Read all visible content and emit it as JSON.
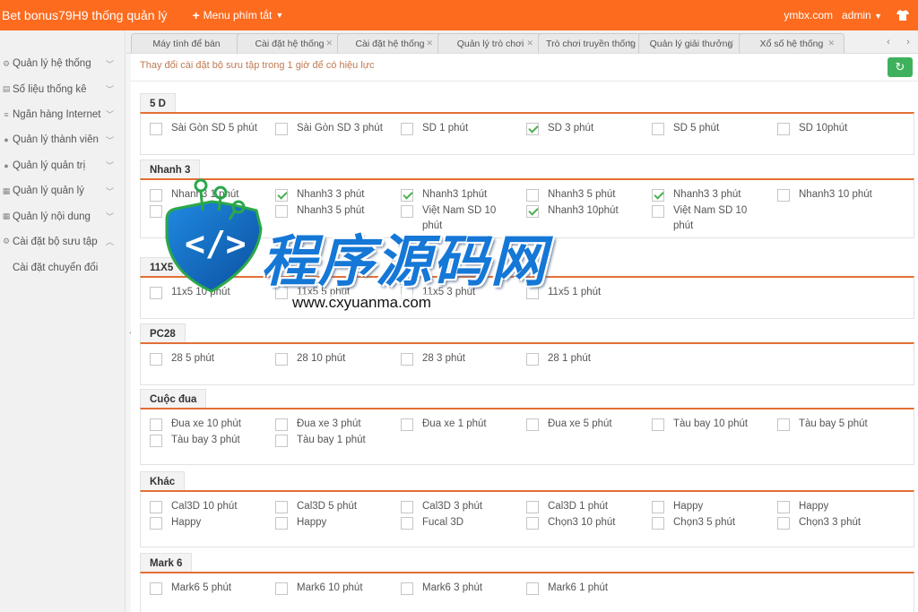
{
  "topbar": {
    "brand": "Bet bonus79H9 thống quản lý",
    "shortcut_label": "Menu phím tắt",
    "domain": "ymbx.com",
    "user": "admin"
  },
  "sidebar": {
    "items": [
      {
        "label": "Quản lý hệ thống",
        "icon": "gear-icon"
      },
      {
        "label": "Số liệu thống kê",
        "icon": "stats-icon"
      },
      {
        "label": "Ngân hàng Internet",
        "icon": "list-icon"
      },
      {
        "label": "Quản lý thành viên",
        "icon": "user-icon"
      },
      {
        "label": "Quản lý quản trị",
        "icon": "admin-icon"
      },
      {
        "label": "Quản lý quản lý",
        "icon": "grid-icon"
      },
      {
        "label": "Quản lý nội dung",
        "icon": "content-icon"
      },
      {
        "label": "Cài đặt bộ sưu tập",
        "icon": "settings-icon"
      }
    ],
    "sub_item": "Cài đặt chuyển đổi"
  },
  "tabs": [
    "Máy tính để bàn",
    "Cài đặt hệ thống",
    "Cài đặt hệ thống",
    "Quản lý trò chơi",
    "Trò chơi truyền thống",
    "Quản lý giải thưởng",
    "Xổ số hệ thống"
  ],
  "content": {
    "notice": "Thay đổi cài đặt bộ sưu tập trong 1 giờ để có hiệu lực"
  },
  "sections": [
    {
      "title": "5 D",
      "rows": [
        [
          {
            "label": "Sài Gòn SD 5 phút",
            "checked": false
          },
          {
            "label": "Sài Gòn SD 3 phút",
            "checked": false
          },
          {
            "label": "SD 1 phút",
            "checked": false
          },
          {
            "label": "SD 3 phút",
            "checked": true
          },
          {
            "label": "SD 5 phút",
            "checked": false
          },
          {
            "label": "SD 10phút",
            "checked": false
          }
        ]
      ]
    },
    {
      "title": "Nhanh 3",
      "rows": [
        [
          {
            "label": "Nhanh3 1 phút",
            "checked": false
          },
          {
            "label": "Nhanh3 3 phút",
            "checked": true
          },
          {
            "label": "Nhanh3 1phút",
            "checked": true
          },
          {
            "label": "Nhanh3 5 phút",
            "checked": false
          },
          {
            "label": "Nhanh3 3 phút",
            "checked": true
          },
          {
            "label": "Nhanh3 10 phút",
            "checked": false
          }
        ],
        [
          {
            "label": "",
            "checked": false
          },
          {
            "label": "Nhanh3 5 phút",
            "checked": false
          },
          {
            "label": "Việt Nam SD 10 phút",
            "checked": false
          },
          {
            "label": "Nhanh3 10phút",
            "checked": true
          },
          {
            "label": "Việt Nam SD 10 phút",
            "checked": false
          }
        ]
      ]
    },
    {
      "title": "11X5",
      "rows": [
        [
          {
            "label": "11x5 10 phút",
            "checked": false
          },
          {
            "label": "11x5 5 phút",
            "checked": false
          },
          {
            "label": "11x5 3 phút",
            "checked": false
          },
          {
            "label": "11x5 1 phút",
            "checked": false
          }
        ]
      ]
    },
    {
      "title": "PC28",
      "rows": [
        [
          {
            "label": "28 5 phút",
            "checked": false
          },
          {
            "label": "28 10 phút",
            "checked": false
          },
          {
            "label": "28 3 phút",
            "checked": false
          },
          {
            "label": "28 1 phút",
            "checked": false
          }
        ]
      ]
    },
    {
      "title": "Cuộc đua",
      "rows": [
        [
          {
            "label": "Đua xe 10 phút",
            "checked": false
          },
          {
            "label": "Đua xe 3 phút",
            "checked": false
          },
          {
            "label": "Đua xe 1 phút",
            "checked": false
          },
          {
            "label": "Đua xe 5 phút",
            "checked": false
          },
          {
            "label": "Tàu bay 10 phút",
            "checked": false
          },
          {
            "label": "Tàu bay 5 phút",
            "checked": false
          }
        ],
        [
          {
            "label": "Tàu bay 3 phút",
            "checked": false
          },
          {
            "label": "Tàu bay 1 phút",
            "checked": false
          }
        ]
      ]
    },
    {
      "title": "Khác",
      "rows": [
        [
          {
            "label": "Cal3D 10 phút",
            "checked": false
          },
          {
            "label": "Cal3D 5 phút",
            "checked": false
          },
          {
            "label": "Cal3D 3 phút",
            "checked": false
          },
          {
            "label": "Cal3D 1 phút",
            "checked": false
          },
          {
            "label": "Happy",
            "checked": false
          },
          {
            "label": "Happy",
            "checked": false
          }
        ],
        [
          {
            "label": "Happy",
            "checked": false
          },
          {
            "label": "Happy",
            "checked": false
          },
          {
            "label": "Fucal 3D",
            "checked": false
          },
          {
            "label": "Chọn3 10 phút",
            "checked": false
          },
          {
            "label": "Chọn3 5 phút",
            "checked": false
          },
          {
            "label": "Chọn3 3 phút",
            "checked": false
          }
        ]
      ]
    },
    {
      "title": "Mark 6",
      "rows": [
        [
          {
            "label": "Mark6 5 phút",
            "checked": false
          },
          {
            "label": "Mark6 10 phút",
            "checked": false
          },
          {
            "label": "Mark6 3 phút",
            "checked": false
          },
          {
            "label": "Mark6 1 phút",
            "checked": false
          }
        ]
      ]
    }
  ],
  "watermark": {
    "text": "程序源码网",
    "url": "www.cxyuanma.com"
  },
  "colors": {
    "topbar": "#fd6b1e",
    "accent_line": "#e36f35",
    "check": "#4caf50",
    "refresh": "#3fb15c"
  }
}
